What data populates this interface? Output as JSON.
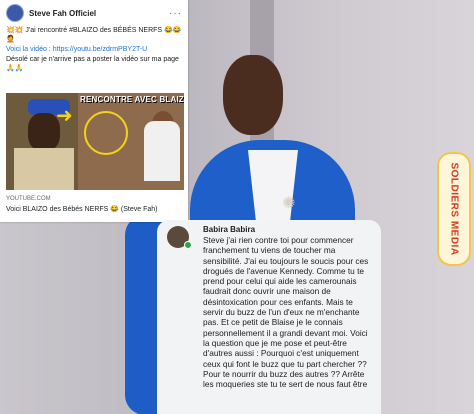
{
  "post": {
    "author": "Steve Fah Officiel",
    "text_lines": [
      "💥💥 J'ai rencontré #BLAIZO des BÉBÉS NERFS 😂😂🤦",
      "Voici la vidéo : https://youtu.be/zdrmPBY2T-U",
      "Désolé car je n'arrive pas a poster la vidéo sur ma page 🙏🙏"
    ],
    "thumbnail_banner": "RENCONTRE AVEC BLAIZO",
    "link_source": "YOUTUBE.COM",
    "link_title": "Voici BLAIZO des Bébés NERFS 😂 (Steve Fah)"
  },
  "watermark": "SOLDIERS MEDIA",
  "comment": {
    "author": "Babira Babira",
    "text": "Steve j'ai rien contre toi pour commencer franchement tu viens de toucher ma sensibilité. J'ai eu toujours le soucis pour ces drogués de l'avenue Kennedy. Comme tu te prend pour celui qui aide les camerounais faudrait donc ouvrir une maison de désintoxication pour ces enfants. Mais te servir du buzz de l'un d'eux ne m'enchante pas. Et ce petit de Blaise je le connais personnellement il a grandi devant moi. Voici la question que je me pose et peut-être d'autres aussi : Pourquoi c'est uniquement ceux qui font le buzz que tu part chercher ?? Pour te nourrir du buzz des autres ?? Arrête les moqueries ste tu te sert de nous faut être"
  },
  "colors": {
    "link": "#1b74e4",
    "jacket": "#1f5fc9",
    "watermark_text": "#d93a1c"
  }
}
